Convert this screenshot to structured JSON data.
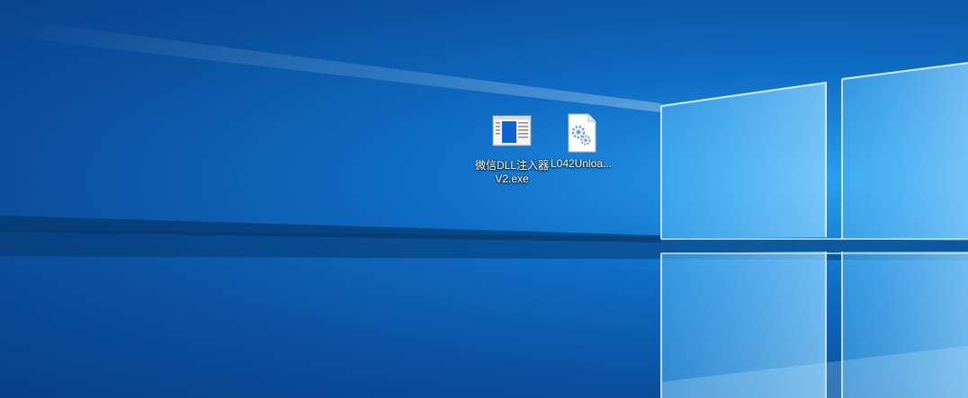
{
  "desktop": {
    "icons": [
      {
        "label": "微信DLL注入器V2.exe",
        "icon": "application-window-icon"
      },
      {
        "label": "L042Unloa...",
        "icon": "settings-file-icon"
      }
    ]
  },
  "colors": {
    "wallpaper_dark": "#083f86",
    "wallpaper_mid": "#0f6cc4",
    "wallpaper_light": "#2aa0ef",
    "window_glow": "#bfe8ff"
  }
}
